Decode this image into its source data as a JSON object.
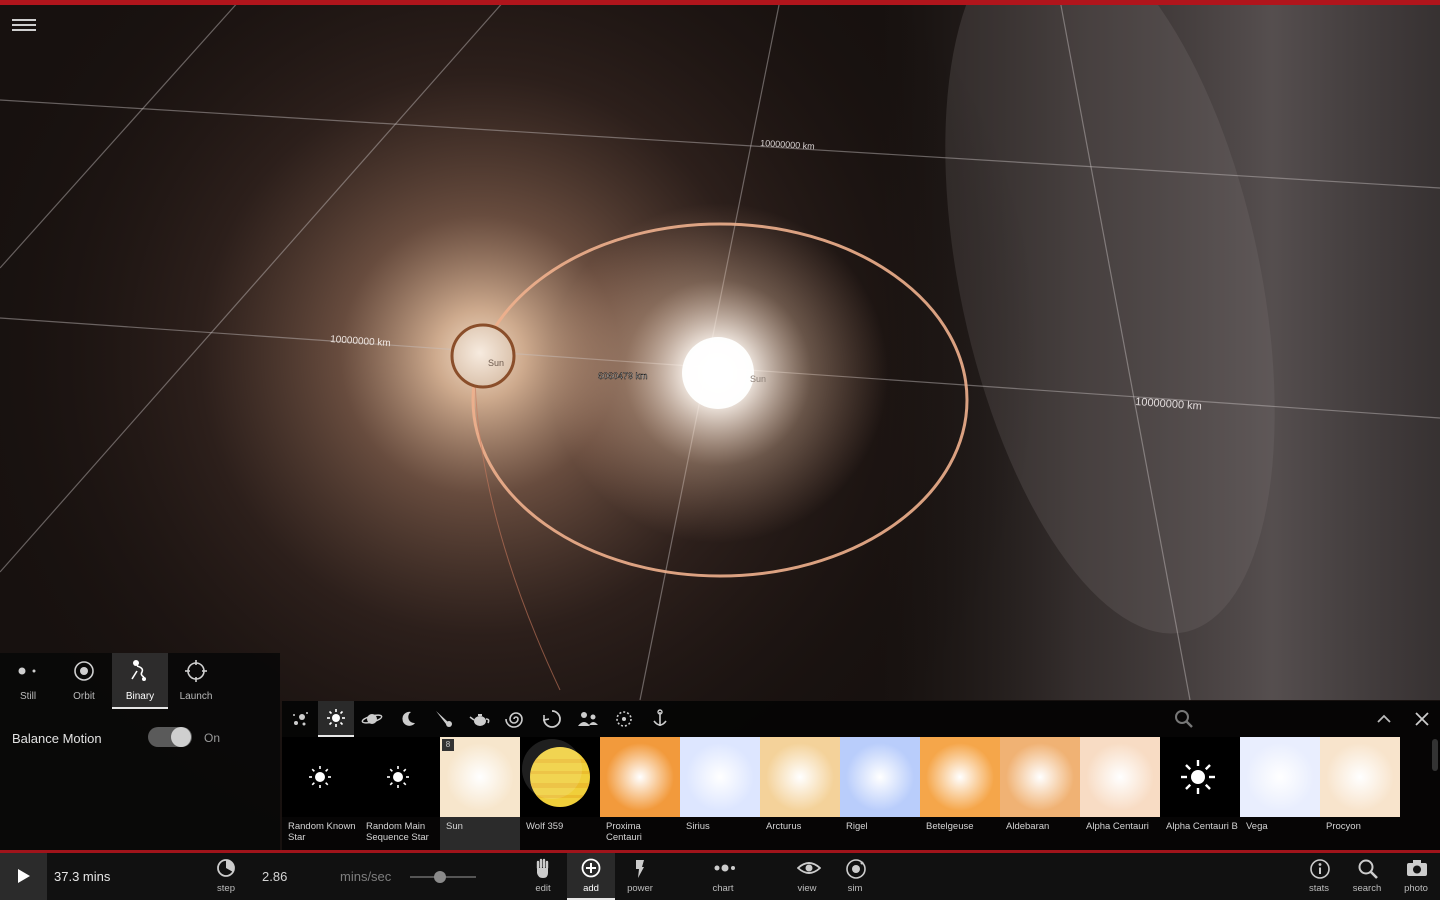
{
  "scene": {
    "distance_label": "6060479 km",
    "grid_labels": [
      "10000000 km",
      "10000000 km",
      "10000000 km"
    ],
    "bodies": [
      {
        "name": "Sun",
        "selected": true
      },
      {
        "name": "Sun",
        "selected": false
      }
    ]
  },
  "motion_modes": [
    {
      "label": "Still",
      "icon": "still-icon",
      "active": false
    },
    {
      "label": "Orbit",
      "icon": "orbit-icon",
      "active": false
    },
    {
      "label": "Binary",
      "icon": "binary-icon",
      "active": true
    },
    {
      "label": "Launch",
      "icon": "launch-icon",
      "active": false
    }
  ],
  "options": {
    "balance_motion_label": "Balance Motion",
    "balance_motion_state": "On"
  },
  "add_panel": {
    "categories": [
      "star-cluster-icon",
      "star-icon",
      "planet-icon",
      "moon-icon",
      "comet-icon",
      "teapot-icon",
      "spiral-galaxy-icon",
      "recycle-icon",
      "people-icon",
      "ring-icon",
      "anchor-icon"
    ],
    "active_category": 1,
    "items": [
      {
        "name": "Random Known Star",
        "kind": "sun-glyph"
      },
      {
        "name": "Random Main Sequence Star",
        "kind": "sun-glyph"
      },
      {
        "name": "Sun",
        "kind": "star",
        "color": "#f7e6cc",
        "count": "8",
        "selected": true
      },
      {
        "name": "Wolf 359",
        "kind": "jovian",
        "color": "#f0cf3a"
      },
      {
        "name": "Proxima Centauri",
        "kind": "star",
        "color": "#f29a3c"
      },
      {
        "name": "Sirius",
        "kind": "star",
        "color": "#dde6ff"
      },
      {
        "name": "Arcturus",
        "kind": "star",
        "color": "#f4d29a"
      },
      {
        "name": "Rigel",
        "kind": "star",
        "color": "#b9cdfb"
      },
      {
        "name": "Betelgeuse",
        "kind": "star",
        "color": "#f5a64a"
      },
      {
        "name": "Aldebaran",
        "kind": "star",
        "color": "#f0b274"
      },
      {
        "name": "Alpha Centauri",
        "kind": "star",
        "color": "#f8dcc4"
      },
      {
        "name": "Alpha Centauri B",
        "kind": "sun-glyph"
      },
      {
        "name": "Vega",
        "kind": "star",
        "color": "#e9eefe"
      },
      {
        "name": "Procyon",
        "kind": "star",
        "color": "#f8e4cc"
      }
    ]
  },
  "bottom_bar": {
    "time": "37.3 mins",
    "rate_value": "2.86",
    "rate_unit": "mins/sec",
    "speed_slider_fraction": 0.45,
    "tools": [
      {
        "label": "step",
        "icon": "step-icon"
      },
      {
        "label": "edit",
        "icon": "hand-icon"
      },
      {
        "label": "add",
        "icon": "add-icon",
        "active": true
      },
      {
        "label": "power",
        "icon": "power-icon"
      },
      {
        "label": "chart",
        "icon": "chart-icon"
      },
      {
        "label": "view",
        "icon": "eye-icon"
      },
      {
        "label": "sim",
        "icon": "sim-icon"
      },
      {
        "label": "stats",
        "icon": "info-icon"
      },
      {
        "label": "search",
        "icon": "search-icon"
      },
      {
        "label": "photo",
        "icon": "camera-icon"
      }
    ]
  },
  "colors": {
    "accent_red": "#b0151c",
    "orbit": "#e9a27a",
    "panel": "#080808"
  }
}
